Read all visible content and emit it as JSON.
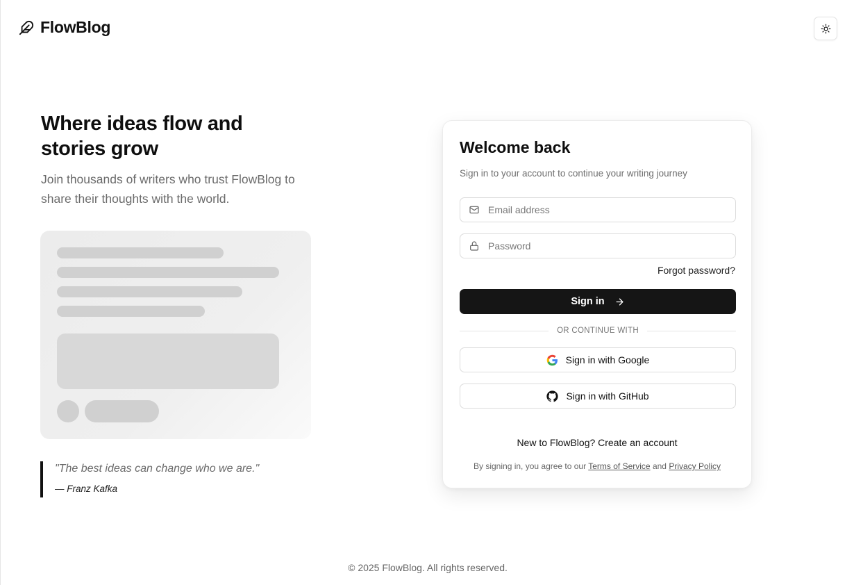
{
  "brand": {
    "name": "FlowBlog",
    "logo_icon": "feather-icon"
  },
  "header": {
    "theme_toggle_icon": "sun-icon"
  },
  "hero": {
    "title": "Where ideas flow and stories grow",
    "subtitle": "Join thousands of writers who trust FlowBlog to share their thoughts with the world."
  },
  "quote": {
    "text": "\"The best ideas can change who we are.\"",
    "author": "— Franz Kafka"
  },
  "login": {
    "title": "Welcome back",
    "subtitle": "Sign in to your account to continue your writing journey",
    "email_placeholder": "Email address",
    "email_icon": "mail-icon",
    "password_placeholder": "Password",
    "password_icon": "lock-icon",
    "forgot_label": "Forgot password?",
    "submit_label": "Sign in",
    "submit_icon": "arrow-right-icon",
    "divider_label": "OR CONTINUE WITH",
    "google_label": "Sign in with Google",
    "github_label": "Sign in with GitHub",
    "new_prompt": "New to FlowBlog?",
    "create_label": "Create an account",
    "legal_prefix": "By signing in, you agree to our",
    "terms_label": "Terms of Service",
    "legal_and": "and",
    "privacy_label": "Privacy Policy"
  },
  "footer": {
    "text": "© 2025 FlowBlog. All rights reserved."
  },
  "colors": {
    "primary_button": "#151515",
    "muted_text": "#6b6b6b",
    "border": "#dcdcdc"
  }
}
